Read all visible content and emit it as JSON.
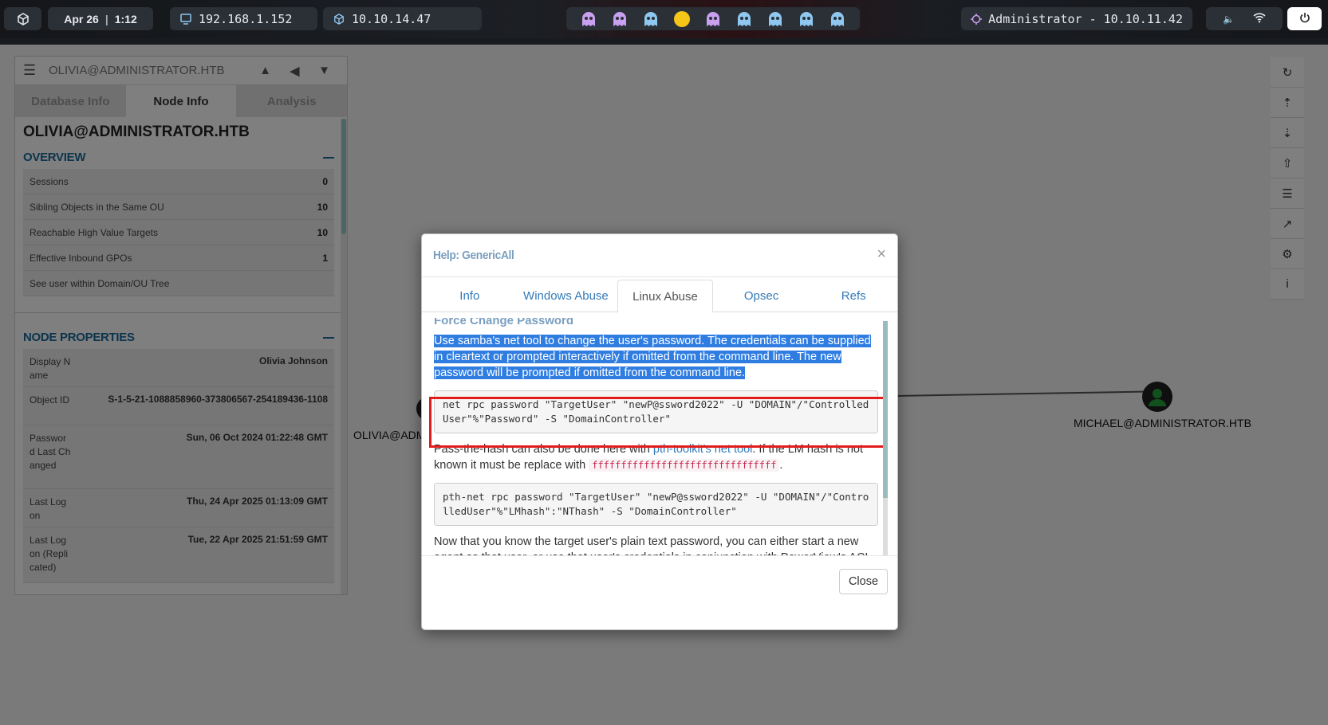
{
  "topbar": {
    "date": "Apr 26",
    "time": "1:12",
    "ip_local": "192.168.1.152",
    "ip_vpn": "10.10.14.47",
    "target": "Administrator - 10.10.11.42"
  },
  "left_panel": {
    "search_text": "OLIVIA@ADMINISTRATOR.HTB",
    "tabs": [
      "Database Info",
      "Node Info",
      "Analysis"
    ],
    "active_tab": "Node Info",
    "node_title": "OLIVIA@ADMINISTRATOR.HTB",
    "overview": {
      "heading": "OVERVIEW",
      "rows": [
        {
          "label": "Sessions",
          "value": "0"
        },
        {
          "label": "Sibling Objects in the Same OU",
          "value": "10"
        },
        {
          "label": "Reachable High Value Targets",
          "value": "10"
        },
        {
          "label": "Effective Inbound GPOs",
          "value": "1"
        },
        {
          "label": "See user within Domain/OU Tree",
          "value": ""
        }
      ]
    },
    "node_properties": {
      "heading": "NODE PROPERTIES",
      "rows": [
        {
          "label": "Display Name",
          "value": "Olivia Johnson"
        },
        {
          "label": "Object ID",
          "value": "S-1-5-21-1088858960-373806567-254189436-1108"
        },
        {
          "label": "Password Last Changed",
          "value": "Sun, 06 Oct 2024 01:22:48 GMT"
        },
        {
          "label": "Last Logon",
          "value": "Thu, 24 Apr 2025 01:13:09 GMT"
        },
        {
          "label": "Last Logon (Replicated)",
          "value": "Tue, 22 Apr 2025 21:51:59 GMT"
        }
      ]
    }
  },
  "graph": {
    "node_left_label": "OLIVIA@ADM",
    "node_right_label": "MICHAEL@ADMINISTRATOR.HTB"
  },
  "modal": {
    "title": "Help: GenericAll",
    "tabs": [
      "Info",
      "Windows Abuse",
      "Linux Abuse",
      "Opsec",
      "Refs"
    ],
    "active_tab": "Linux Abuse",
    "sub_heading": "Force Change Password",
    "para1": "Use samba's net tool to change the user's password. The credentials can be supplied in cleartext or prompted interactively if omitted from the command line. The new password will be prompted if omitted from the command line.",
    "code1": "net rpc password \"TargetUser\" \"newP@ssword2022\" -U \"DOMAIN\"/\"ControlledUser\"%\"Password\" -S \"DomainController\"",
    "para2_a": "Pass-the-hash can also be done here with ",
    "para2_link": "pth-toolkit's net tool",
    "para2_b": ". If the LM hash is not known it must be replace with ",
    "para2_hash": "ffffffffffffffffffffffffffffffff",
    "para2_c": ".",
    "code2": "pth-net rpc password \"TargetUser\" \"newP@ssword2022\" -U \"DOMAIN\"/\"ControlledUser\"%\"LMhash\":\"NThash\" -S \"DomainController\"",
    "para3": "Now that you know the target user's plain text password, you can either start a new agent as that user, or use that user's credentials in conjunction with PowerView's ACL abuse",
    "close_label": "Close"
  },
  "colors": {
    "accent": "#337ab7",
    "highlight_box": "#e31b1b",
    "selection": "#2f7de1"
  }
}
